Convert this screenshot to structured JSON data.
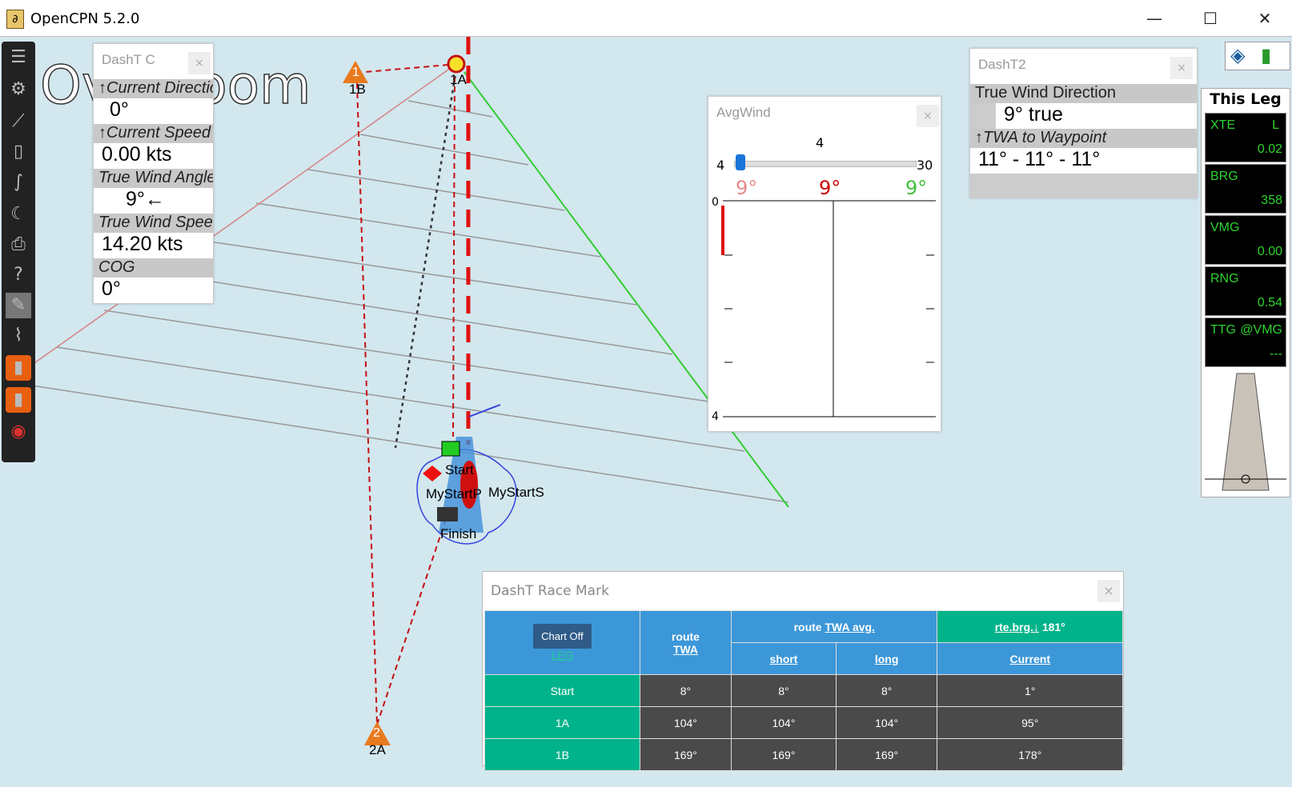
{
  "window": {
    "title": "OpenCPN 5.2.0",
    "minimize": "—",
    "maximize": "☐",
    "close": "✕"
  },
  "map_labels": {
    "overzoom": "Overzoom",
    "mark_1": "1",
    "mark_1B": "1B",
    "mark_1A": "1A",
    "mark_2": "2",
    "mark_2A": "2A",
    "start": "Start",
    "mystart_p": "MyStartP",
    "mystart_s": "MyStartS",
    "finish": "Finish"
  },
  "dash_c": {
    "caption": "DashT C",
    "close": "×",
    "rows": [
      {
        "label": "↑Current Direction",
        "value": "0°"
      },
      {
        "label": "↑Current Speed",
        "value": "0.00 kts"
      },
      {
        "label": "True Wind Angle",
        "value": "9°←"
      },
      {
        "label": "True Wind Speed",
        "value": "14.20 kts"
      },
      {
        "label": "COG",
        "value": "0°"
      }
    ]
  },
  "avgwind": {
    "caption": "AvgWind",
    "close": "×",
    "slider_value": "4",
    "slider_min": "4",
    "slider_max": "30",
    "angle_left": "9°",
    "angle_mid": "9°",
    "angle_right": "9°",
    "axis_top": "0",
    "axis_bottom": "4",
    "colors": {
      "left": "#e88a8a",
      "mid": "#cc0000",
      "right": "#3fbf3f"
    }
  },
  "dash_t2": {
    "caption": "DashT2",
    "close": "×",
    "rows": [
      {
        "label": "True Wind Direction",
        "value": "9° true"
      },
      {
        "label": "↑TWA to Waypoint",
        "value": "11° - 11° - 11°"
      }
    ]
  },
  "this_leg": {
    "title": "This Leg",
    "boxes": [
      {
        "label": "XTE",
        "label2": "L",
        "value": "0.02"
      },
      {
        "label": "BRG",
        "label2": "",
        "value": "358"
      },
      {
        "label": "VMG",
        "label2": "",
        "value": "0.00"
      },
      {
        "label": "RNG",
        "label2": "",
        "value": "0.54"
      },
      {
        "label": "TTG",
        "label2": "@VMG",
        "value": "---"
      }
    ]
  },
  "race_mark": {
    "caption": "DashT Race Mark",
    "close": "×",
    "chart_off": "Chart Off",
    "leg": "LEG",
    "route_twa_a": "route",
    "route_twa_b": "TWA",
    "route_twa_avg_a": "route",
    "route_twa_avg_b": "TWA avg.",
    "rte_brg": "rte.brg.↓",
    "rte_brg_val": "181°",
    "short": "short",
    "long": "long",
    "current": "Current",
    "rows": [
      {
        "leg": "Start",
        "twa": "8°",
        "short": "8°",
        "long": "8°",
        "current": "1°"
      },
      {
        "leg": "1A",
        "twa": "104°",
        "short": "104°",
        "long": "104°",
        "current": "95°"
      },
      {
        "leg": "1B",
        "twa": "169°",
        "short": "169°",
        "long": "169°",
        "current": "178°"
      }
    ]
  }
}
